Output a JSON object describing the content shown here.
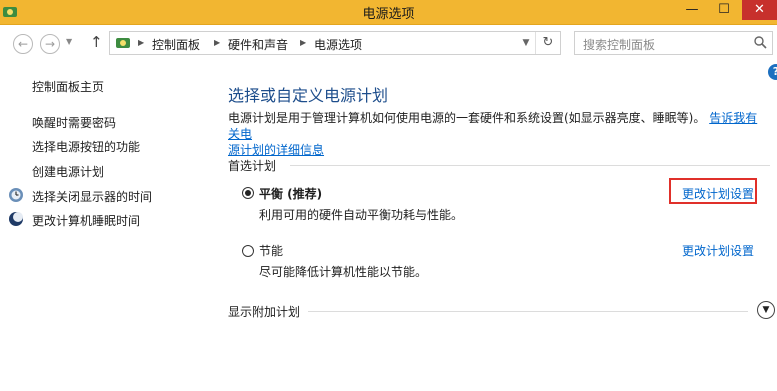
{
  "window": {
    "title": "电源选项",
    "minimize_glyph": "—",
    "maximize_glyph": "☐",
    "close_glyph": "✕"
  },
  "nav": {
    "back_glyph": "←",
    "forward_glyph": "→",
    "up_glyph": "↑",
    "breadcrumbs": [
      "控制面板",
      "硬件和声音",
      "电源选项"
    ],
    "refresh_glyph": "↻",
    "search_placeholder": "搜索控制面板"
  },
  "sidebar": {
    "home_label": "控制面板主页",
    "items": [
      {
        "label": "唤醒时需要密码",
        "icon": null
      },
      {
        "label": "选择电源按钮的功能",
        "icon": null
      },
      {
        "label": "创建电源计划",
        "icon": null
      },
      {
        "label": "选择关闭显示器的时间",
        "icon": "monitor-icon"
      },
      {
        "label": "更改计算机睡眠时间",
        "icon": "moon-icon"
      }
    ]
  },
  "main": {
    "title": "选择或自定义电源计划",
    "description": "电源计划是用于管理计算机如何使用电源的一套硬件和系统设置(如显示器亮度、睡眠等)。",
    "description_link_line1": "告诉我有关电",
    "description_link_line2": "源计划的详细信息",
    "preferred_section": "首选计划",
    "plans": [
      {
        "name": "平衡 (推荐)",
        "description": "利用可用的硬件自动平衡功耗与性能。",
        "selected": true,
        "change_link": "更改计划设置"
      },
      {
        "name": "节能",
        "description": "尽可能降低计算机性能以节能。",
        "selected": false,
        "change_link": "更改计划设置"
      }
    ],
    "more_plans_section": "显示附加计划"
  },
  "colors": {
    "titlebar": "#f2b631",
    "link": "#0066cc",
    "heading": "#1e4e8c",
    "highlight": "#e0302a",
    "close_button": "#c7302c"
  }
}
